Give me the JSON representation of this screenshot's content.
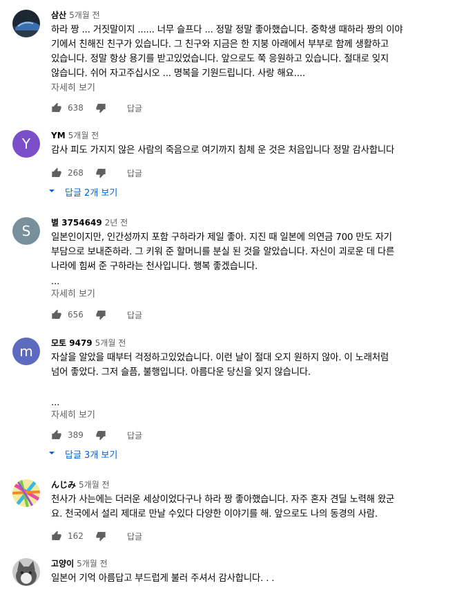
{
  "comments": [
    {
      "author": "삼산",
      "time": "5개월 전",
      "lines": [
        "하라 짱 ... 거짓말이지 ...... 너무 슬프다 ... 정말 정말 좋아했습니다. 중학생 때하라 짱의 이야",
        "기에서 친해진 친구가 있습니다. 그 친구와 지금은 한 지붕 아래에서 부부로 함께 생활하고",
        "있습니다. 정말 항상 용기를 받고있었습니다. 앞으로도 쭉 응원하고 있습니다. 절대로 잊지",
        "않습니다. 쉬어 자고주십시오 ... 명복을 기원드립니다. 사랑 해요...."
      ],
      "more": "자세히 보기",
      "likes": "638",
      "reply": "답글"
    },
    {
      "author": "YM",
      "time": "5개월 전",
      "lines": [
        "감사 피도 가지지 않은 사람의 죽음으로 여기까지 침체 운 것은 처음입니다 정말 감사합니다"
      ],
      "likes": "268",
      "reply": "답글",
      "replies": "답글 2개 보기"
    },
    {
      "author": "별 3754649",
      "time": "2년 전",
      "lines": [
        "일본인이지만, 인간성까지 포함 구하라가 제일 좋아. 지진 때 일본에 의연금 700 만도 자기",
        "부담으로 보내준하라. 그 키워 준 할머니를 분실 된 것을 알았습니다. 자신이 괴로운 데 다른",
        "나라에 힘써 준 구하라는 천사입니다. 행복 좋겠습니다."
      ],
      "ellipsis": "...",
      "more": "자세히 보기",
      "likes": "656",
      "reply": "답글"
    },
    {
      "author": "모토 9479",
      "time": "5개월 전",
      "lines": [
        "자살을 알았을 때부터 걱정하고있었습니다. 이런 날이 절대 오지 원하지 않아. 이 노래처럼",
        "넘어 좋았다. 그저 슬픔, 불행입니다. 아름다운 당신을 잊지 않습니다."
      ],
      "ellipsis": "...",
      "more": "자세히 보기",
      "likes": "389",
      "reply": "답글",
      "replies": "답글 3개 보기"
    },
    {
      "author": "んじみ",
      "time": "5개월 전",
      "lines": [
        "천사가 사는에는 더러운 세상이었다구나 하라 짱 좋아했습니다. 자주 혼자 견딜 노력해 왔군",
        "요. 천국에서 설리 제대로 만날 수있다 다양한 이야기를 해. 앞으로도 나의 동경의 사람."
      ],
      "likes": "162",
      "reply": "답글"
    },
    {
      "author": "고양이",
      "time": "5개월 전",
      "lines": [
        "일본어 기억 아름답고 부드럽게 불러 주셔서 감사합니다. . ."
      ]
    }
  ],
  "avatars": {
    "YM": {
      "letter": "Y",
      "color": "#7b4fc9"
    },
    "star": {
      "letter": "S",
      "color": "#78909c"
    },
    "moto": {
      "letter": "m",
      "color": "#5c6bc0"
    }
  },
  "icons": {
    "like": "thumb-up-icon",
    "dislike": "thumb-down-icon",
    "expand": "chevron-down-icon"
  },
  "colors": {
    "link": "#065fd4",
    "meta": "#606060",
    "text": "#030303"
  }
}
